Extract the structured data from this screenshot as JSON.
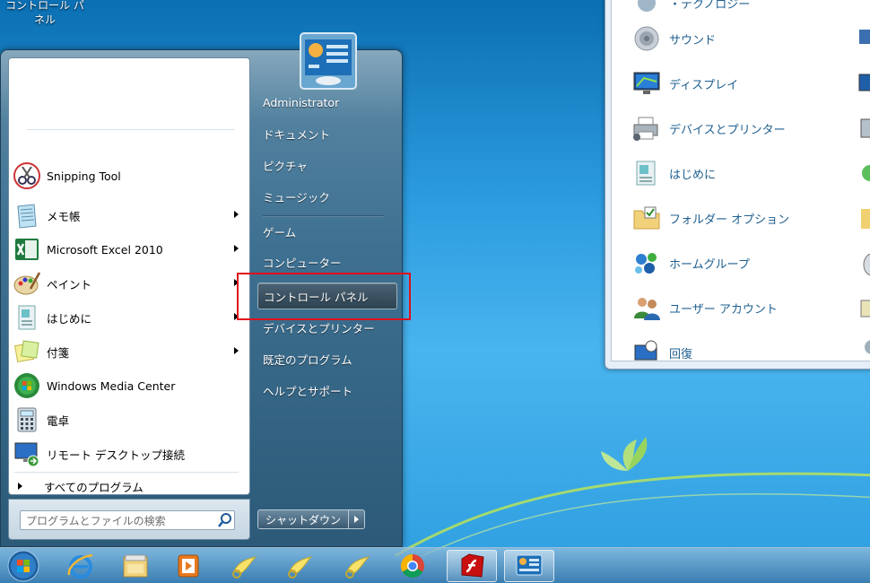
{
  "desktop": {
    "icon_label": "コントロール パネル"
  },
  "start_menu": {
    "pinned_programs": [
      {
        "label": "Snipping Tool",
        "icon": "scissors-icon",
        "has_submenu": false
      },
      {
        "label": "メモ帳",
        "icon": "notepad-icon",
        "has_submenu": true
      },
      {
        "label": "Microsoft Excel 2010",
        "icon": "excel-icon",
        "has_submenu": true
      },
      {
        "label": "ペイント",
        "icon": "paint-palette-icon",
        "has_submenu": true
      },
      {
        "label": "はじめに",
        "icon": "getting-started-icon",
        "has_submenu": true
      },
      {
        "label": "付箋",
        "icon": "sticky-notes-icon",
        "has_submenu": true
      },
      {
        "label": "Windows Media Center",
        "icon": "media-center-icon",
        "has_submenu": false
      },
      {
        "label": "電卓",
        "icon": "calculator-icon",
        "has_submenu": false
      },
      {
        "label": "リモート デスクトップ接続",
        "icon": "remote-desktop-icon",
        "has_submenu": false
      }
    ],
    "all_programs": "すべてのプログラム",
    "search_placeholder": "プログラムとファイルの検索",
    "right_items": [
      {
        "label": "Administrator"
      },
      {
        "label": "ドキュメント"
      },
      {
        "label": "ピクチャ"
      },
      {
        "label": "ミュージック"
      },
      {
        "label": "ゲーム"
      },
      {
        "label": "コンピューター"
      },
      {
        "label": "コントロール パネル",
        "highlighted": true
      },
      {
        "label": "デバイスとプリンター"
      },
      {
        "label": "既定のプログラム"
      },
      {
        "label": "ヘルプとサポート"
      }
    ],
    "shutdown_label": "シャットダウン",
    "highlight_color": "#e0101a"
  },
  "control_panel": {
    "items": [
      {
        "label": "・テクノロジー",
        "icon": "tech-icon"
      },
      {
        "label": "サウンド",
        "icon": "speaker-icon"
      },
      {
        "label": "ディスプレイ",
        "icon": "display-icon"
      },
      {
        "label": "デバイスとプリンター",
        "icon": "printer-icon"
      },
      {
        "label": "はじめに",
        "icon": "getting-started-icon"
      },
      {
        "label": "フォルダー オプション",
        "icon": "folder-options-icon"
      },
      {
        "label": "ホームグループ",
        "icon": "homegroup-icon"
      },
      {
        "label": "ユーザー アカウント",
        "icon": "user-accounts-icon"
      },
      {
        "label": "回復",
        "icon": "recovery-icon"
      }
    ]
  },
  "taskbar": {
    "items": [
      "start-orb-icon",
      "internet-explorer-icon",
      "file-explorer-icon",
      "media-player-icon",
      "app-icon",
      "app-icon",
      "app-icon",
      "chrome-icon",
      "flash-icon",
      "control-panel-icon"
    ]
  }
}
